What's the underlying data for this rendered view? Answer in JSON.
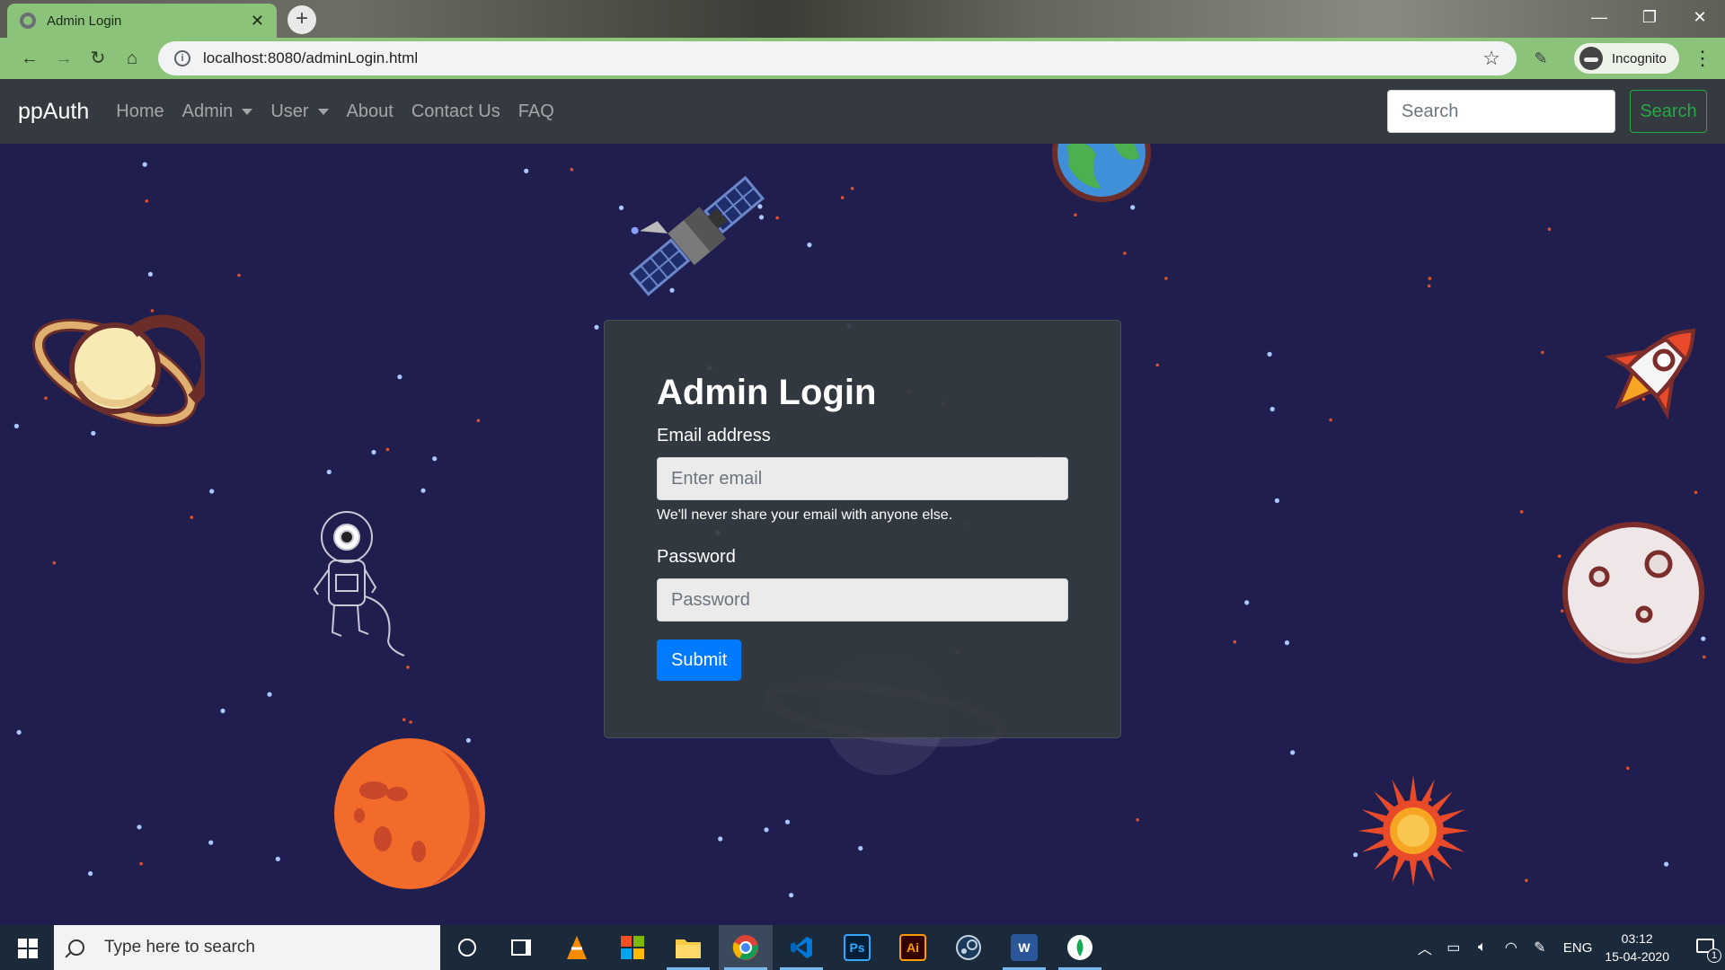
{
  "browser": {
    "tab_title": "Admin Login",
    "tab_close": "✕",
    "new_tab": "+",
    "url": "localhost:8080/adminLogin.html",
    "incognito_label": "Incognito",
    "window_controls": {
      "minimize": "—",
      "restore": "❐",
      "close": "✕"
    },
    "nav": {
      "back": "←",
      "forward": "→",
      "reload": "↻",
      "home": "⌂"
    }
  },
  "site_nav": {
    "brand": "ppAuth",
    "links": [
      {
        "label": "Home"
      },
      {
        "label": "Admin"
      },
      {
        "label": "User"
      },
      {
        "label": "About"
      },
      {
        "label": "Contact Us"
      },
      {
        "label": "FAQ"
      }
    ],
    "search_placeholder": "Search",
    "search_button": "Search"
  },
  "login": {
    "title": "Admin Login",
    "email_label": "Email address",
    "email_placeholder": "Enter email",
    "email_help": "We'll never share your email with anyone else.",
    "password_label": "Password",
    "password_placeholder": "Password",
    "submit_label": "Submit"
  },
  "taskbar": {
    "search_placeholder": "Type here to search",
    "apps": [
      "cortana-icon",
      "task-view-icon",
      "vlc-icon",
      "store-icon",
      "file-explorer-icon",
      "chrome-icon",
      "vscode-icon",
      "photoshop-icon",
      "illustrator-icon",
      "steam-icon",
      "word-icon",
      "mongodb-icon"
    ],
    "app_labels": {
      "ps": "Ps",
      "ai": "Ai",
      "word": "W"
    },
    "language": "ENG",
    "time": "03:12",
    "date": "15-04-2020",
    "notification_count": "1"
  },
  "colors": {
    "browser_accent": "#8bc37a",
    "navbar_bg": "#343a40",
    "space_bg": "#201e4e",
    "primary_button": "#007bff",
    "search_button": "#28a745"
  }
}
